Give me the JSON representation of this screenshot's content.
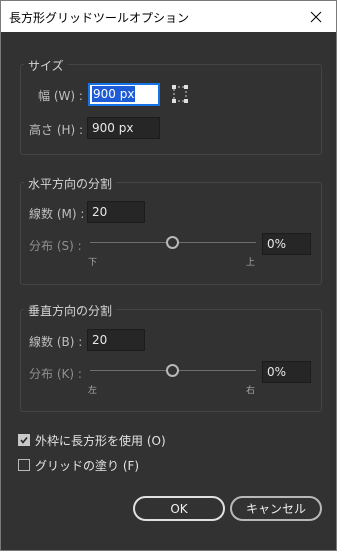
{
  "window": {
    "title": "長方形グリッドツールオプション",
    "close_icon": "close-icon"
  },
  "size": {
    "legend": "サイズ",
    "width_label": "幅 (W) :",
    "width_value": "900 px",
    "height_label": "高さ (H) :",
    "height_value": "900 px",
    "link_icon": "constrain-proportions-icon"
  },
  "horizontal": {
    "legend": "水平方向の分割",
    "count_label": "線数 (M) :",
    "count_value": "20",
    "skew_label": "分布 (S) :",
    "skew_value": "0%",
    "skew_level": 0.5,
    "min_label": "下",
    "max_label": "上"
  },
  "vertical": {
    "legend": "垂直方向の分割",
    "count_label": "線数 (B) :",
    "count_value": "20",
    "skew_label": "分布 (K) :",
    "skew_value": "0%",
    "skew_level": 0.5,
    "min_label": "左",
    "max_label": "右"
  },
  "options": {
    "outer_rect_label": "外枠に長方形を使用 (O)",
    "outer_rect_checked": true,
    "fill_grid_label": "グリッドの塗り (F)",
    "fill_grid_checked": false
  },
  "buttons": {
    "ok": "OK",
    "cancel": "キャンセル"
  }
}
